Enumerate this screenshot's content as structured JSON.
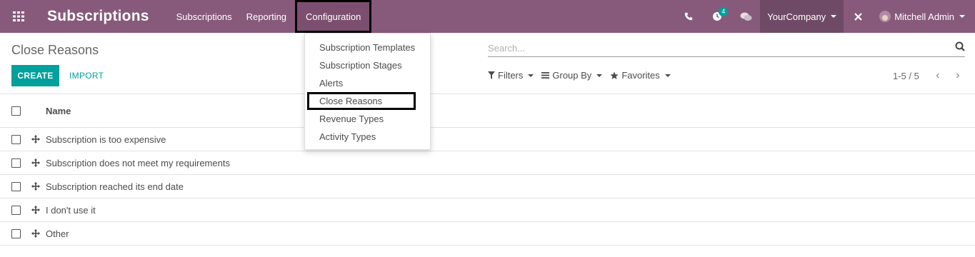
{
  "navbar": {
    "app_title": "Subscriptions",
    "menu": [
      "Subscriptions",
      "Reporting",
      "Configuration"
    ],
    "activity_count": "4",
    "company": "YourCompany",
    "user": "Mitchell Admin",
    "icons": [
      "apps-grid-icon",
      "phone-icon",
      "clock-activity-icon",
      "chat-icon",
      "debug-close-icon",
      "user-avatar"
    ]
  },
  "config_menu": {
    "items": [
      "Subscription Templates",
      "Subscription Stages",
      "Alerts",
      "Close Reasons",
      "Revenue Types",
      "Activity Types"
    ],
    "highlighted": "Close Reasons"
  },
  "control_panel": {
    "breadcrumb": "Close Reasons",
    "search_placeholder": "Search...",
    "create_label": "CREATE",
    "import_label": "IMPORT",
    "filters_label": "Filters",
    "groupby_label": "Group By",
    "favorites_label": "Favorites",
    "pager": "1-5 / 5"
  },
  "table": {
    "column_name": "Name",
    "rows": [
      "Subscription is too expensive",
      "Subscription does not meet my requirements",
      "Subscription reached its end date",
      "I don't use it",
      "Other"
    ]
  },
  "colors": {
    "navbar": "#875a7b",
    "accent": "#00a09d"
  }
}
